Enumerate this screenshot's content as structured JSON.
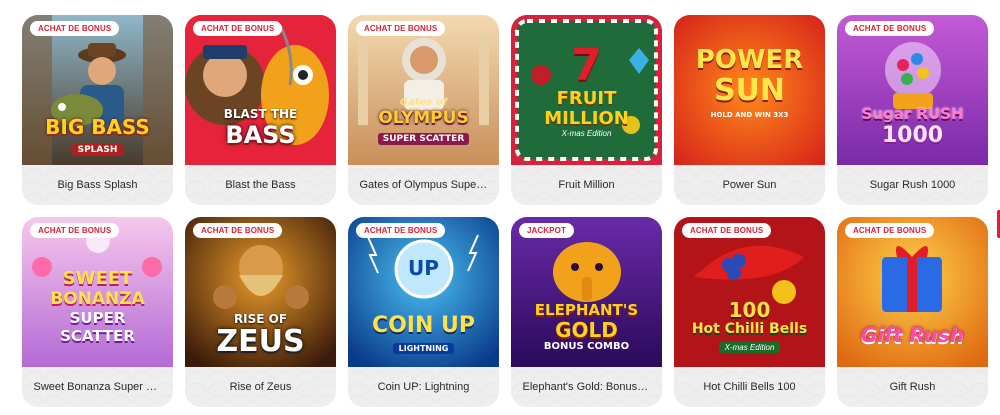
{
  "games": [
    {
      "title": "Big Bass Splash",
      "badge": "ACHAT DE BONUS",
      "art_text": [
        "BIG BASS",
        "SPLASH"
      ]
    },
    {
      "title": "Blast the Bass",
      "badge": "ACHAT DE BONUS",
      "art_text": [
        "BLAST THE",
        "BASS"
      ]
    },
    {
      "title": "Gates of Olympus Super Scatter",
      "badge": "ACHAT DE BONUS",
      "art_text": [
        "Gates of",
        "OLYMPUS",
        "SUPER SCATTER"
      ]
    },
    {
      "title": "Fruit Million",
      "badge": "",
      "art_text": [
        "7",
        "FRUIT",
        "MILLION",
        "X-mas Edition"
      ]
    },
    {
      "title": "Power Sun",
      "badge": "",
      "art_text": [
        "POWER",
        "SUN",
        "HOLD AND WIN 3X3"
      ]
    },
    {
      "title": "Sugar Rush 1000",
      "badge": "ACHAT DE BONUS",
      "art_text": [
        "Sugar RUSH",
        "1000"
      ]
    },
    {
      "title": "Sweet Bonanza Super Scatter",
      "badge": "ACHAT DE BONUS",
      "art_text": [
        "SWEET",
        "BONANZA",
        "SUPER",
        "SCATTER"
      ]
    },
    {
      "title": "Rise of Zeus",
      "badge": "ACHAT DE BONUS",
      "art_text": [
        "RISE OF",
        "ZEUS"
      ]
    },
    {
      "title": "Coin UP: Lightning",
      "badge": "ACHAT DE BONUS",
      "art_text": [
        "UP",
        "COIN UP",
        "LIGHTNING"
      ]
    },
    {
      "title": "Elephant's Gold: Bonus Combo",
      "badge": "JACKPOT",
      "art_text": [
        "ELEPHANT'S",
        "GOLD",
        "BONUS COMBO"
      ]
    },
    {
      "title": "Hot Chilli Bells 100",
      "badge": "ACHAT DE BONUS",
      "art_text": [
        "100",
        "Hot Chilli Bells",
        "X-mas Edition"
      ]
    },
    {
      "title": "Gift Rush",
      "badge": "ACHAT DE BONUS",
      "art_text": [
        "Gift Rush"
      ]
    }
  ],
  "colors": {
    "badge_text": "#d6223a",
    "caption_bg": "#efeeee"
  }
}
